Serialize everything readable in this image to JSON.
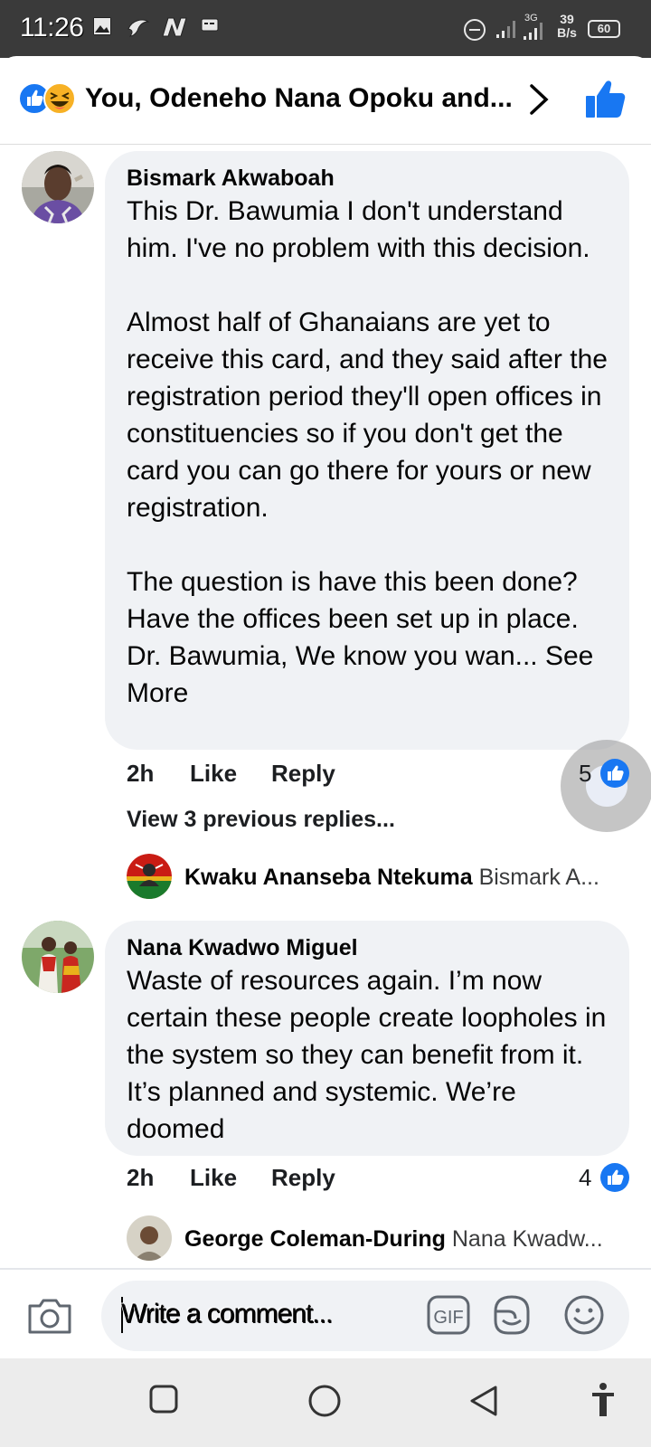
{
  "status_bar": {
    "time": "11:26",
    "network": "3G",
    "speed_value": "39",
    "speed_unit": "B/s",
    "battery": "60"
  },
  "header": {
    "title": "You, Odeneho Nana Opoku and...",
    "reaction_icons": [
      "like-icon",
      "haha-icon"
    ]
  },
  "comments": [
    {
      "author": "Bismark Akwaboah",
      "text": "This Dr. Bawumia I don't understand him. I've no problem with this decision.\n\nAlmost half of Ghanaians are yet to receive this card, and they said after the registration period they'll open offices in constituencies so if you don't get the card you can go there for yours or new registration.\n\nThe question is have this been done? Have the offices been set up in place. Dr. Bawumia, We know you wan...",
      "see_more": "See More",
      "time": "2h",
      "like": "Like",
      "reply": "Reply",
      "likes": "5",
      "view_previous": "View 3 previous replies...",
      "reply_preview": {
        "author": "Kwaku Ananseba Ntekuma",
        "text": "Bismark A..."
      }
    },
    {
      "author": "Nana Kwadwo Miguel",
      "text": "Waste of resources again. I’m now certain these people create loopholes in the system so they can benefit from it. It’s planned and systemic. We’re doomed",
      "time": "2h",
      "like": "Like",
      "reply": "Reply",
      "likes": "4",
      "reply_preview": {
        "author": "George Coleman-During",
        "text": "Nana Kwadw..."
      }
    }
  ],
  "composer": {
    "placeholder": "Write a comment...",
    "gif_label": "GIF"
  },
  "colors": {
    "brand_blue": "#1877f2",
    "bubble_bg": "#f0f2f5",
    "statusbar_bg": "#3a3a3a"
  }
}
